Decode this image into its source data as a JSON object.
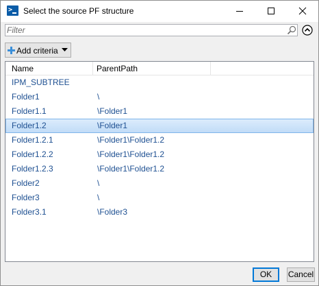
{
  "window": {
    "title": "Select the source PF structure",
    "icon": "powershell-icon",
    "controls": [
      "minimize-icon",
      "maximize-icon",
      "close-icon"
    ]
  },
  "filter": {
    "placeholder": "Filter",
    "value": "",
    "search_icon": "search-icon",
    "collapse_icon": "chevron-up-circle-icon"
  },
  "criteria": {
    "label": "Add criteria",
    "icon": "plus-icon",
    "dropdown_icon": "caret-down-icon"
  },
  "list": {
    "columns": [
      "Name",
      "ParentPath"
    ],
    "rows": [
      {
        "name": "IPM_SUBTREE",
        "path": ""
      },
      {
        "name": "Folder1",
        "path": "\\"
      },
      {
        "name": "Folder1.1",
        "path": "\\Folder1"
      },
      {
        "name": "Folder1.2",
        "path": "\\Folder1",
        "selected": true
      },
      {
        "name": "Folder1.2.1",
        "path": "\\Folder1\\Folder1.2"
      },
      {
        "name": "Folder1.2.2",
        "path": "\\Folder1\\Folder1.2"
      },
      {
        "name": "Folder1.2.3",
        "path": "\\Folder1\\Folder1.2"
      },
      {
        "name": "Folder2",
        "path": "\\"
      },
      {
        "name": "Folder3",
        "path": "\\"
      },
      {
        "name": "Folder3.1",
        "path": "\\Folder3"
      }
    ]
  },
  "footer": {
    "ok_label": "OK",
    "cancel_label": "Cancel"
  },
  "colors": {
    "row_text": "#1d4f91",
    "selection_border": "#7eb4ea",
    "default_button_border": "#0078d7"
  }
}
